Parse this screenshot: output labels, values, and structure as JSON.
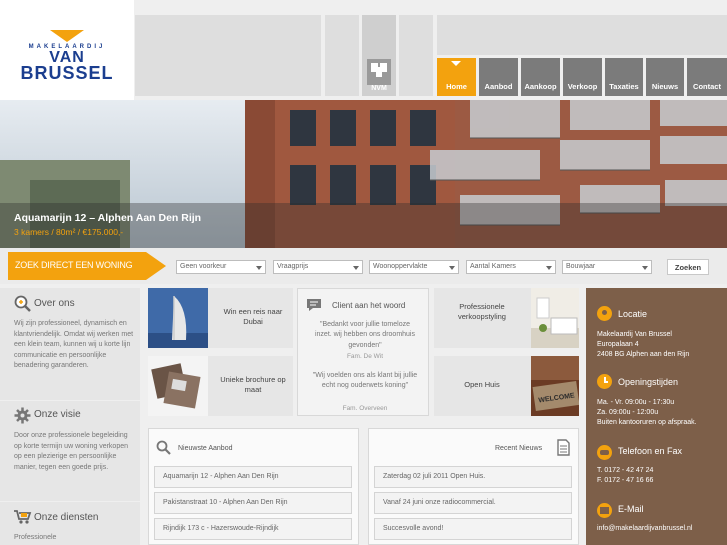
{
  "logo": {
    "top": "MAKELAARDIJ",
    "name_line1": "VAN",
    "name_line2": "BRUSSEL"
  },
  "nvm_label": "NVM",
  "nav": [
    "Home",
    "Aanbod",
    "Aankoop",
    "Verkoop",
    "Taxaties",
    "Nieuws",
    "Contact"
  ],
  "hero": {
    "title": "Aquamarijn 12 – Alphen Aan Den Rijn",
    "subtitle": "3 kamers / 80m² / €175.000,-"
  },
  "search": {
    "heading": "ZOEK DIRECT EEN WONING",
    "fields": [
      "Geen voorkeur",
      "Vraagprijs",
      "Woonoppervlakte",
      "Aantal Kamers",
      "Bouwjaar"
    ],
    "button": "Zoeken"
  },
  "left": [
    {
      "title": "Over ons",
      "text": "Wij zijn professioneel, dynamisch en klantvriendelijk. Omdat wij werken met een klein team, kunnen wij u korte lijn communicatie en persoonlijke benadering garanderen."
    },
    {
      "title": "Onze visie",
      "text": "Door onze professionele begeleiding op korte termijn uw woning verkopen op een plezierige en persoonlijke manier, tegen een goede prijs."
    },
    {
      "title": "Onze diensten",
      "text": "Professionele"
    }
  ],
  "tiles": {
    "reis": "Win een reis naar Dubai",
    "brochure": "Unieke brochure op maat",
    "styling": "Professionele verkoopstyling",
    "open_huis": "Open Huis"
  },
  "client": {
    "title": "Client aan het woord",
    "quote1": "\"Bedankt voor jullie tomeloze inzet. wij hebben ons droomhuis gevonden\"",
    "author1": "Fam. De Wit",
    "quote2": "\"Wij voelden ons als klant bij jullie echt nog ouderwets koning\"",
    "author2": "Fam. Overveen"
  },
  "aanbod": {
    "title": "Nieuwste Aanbod",
    "items": [
      "Aquamarijn 12 - Alphen Aan Den Rijn",
      "Pakistanstraat 10 - Alphen Aan Den Rijn",
      "Rijndijk 173 c - Hazerswoude-Rijndijk"
    ]
  },
  "nieuws": {
    "title": "Recent Nieuws",
    "items": [
      "Zaterdag 02 juli 2011 Open Huis.",
      "Vanaf 24 juni onze radiocommercial.",
      "Succesvolle avond!"
    ]
  },
  "contact": {
    "locatie": {
      "title": "Locatie",
      "lines": [
        "Makelaardij Van Brussel",
        "Europalaan 4",
        "2408 BG Alphen aan den Rijn"
      ]
    },
    "tijden": {
      "title": "Openingstijden",
      "lines": [
        "Ma. - Vr. 09:00u - 17:30u",
        "Za. 09:00u - 12:00u",
        "Buiten kantooruren op afspraak."
      ]
    },
    "telefoon": {
      "title": "Telefoon en Fax",
      "lines": [
        "T. 0172 - 42 47 24",
        "F. 0172 - 47 16 66"
      ]
    },
    "email": {
      "title": "E-Mail",
      "lines": [
        "info@makelaardijvanbrussel.nl"
      ]
    }
  },
  "colors": {
    "accent": "#f3a20e",
    "brand": "#1b3e8f",
    "contact_bg": "#7d5f49",
    "nav": "#7b7b7b"
  }
}
